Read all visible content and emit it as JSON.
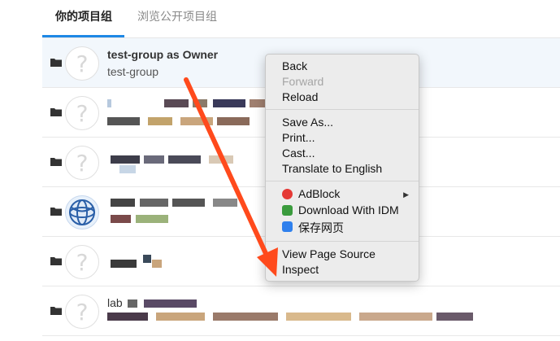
{
  "tabs": [
    {
      "label": "你的项目组",
      "active": true
    },
    {
      "label": "浏览公开项目组",
      "active": false
    }
  ],
  "groups": [
    {
      "name": "test-group as Owner",
      "path": "test-group",
      "avatar": "question-mark"
    },
    {
      "name": "",
      "path": "",
      "avatar": "question-mark"
    },
    {
      "name": "",
      "path": "",
      "avatar": "question-mark"
    },
    {
      "name": "",
      "path": "",
      "avatar": "globe-logo"
    },
    {
      "name": "",
      "path": "",
      "avatar": "question-mark"
    },
    {
      "name": "lab",
      "path": "",
      "avatar": "question-mark"
    }
  ],
  "context_menu": {
    "sections": [
      [
        {
          "label": "Back",
          "enabled": true
        },
        {
          "label": "Forward",
          "enabled": false
        },
        {
          "label": "Reload",
          "enabled": true
        }
      ],
      [
        {
          "label": "Save As...",
          "enabled": true
        },
        {
          "label": "Print...",
          "enabled": true
        },
        {
          "label": "Cast...",
          "enabled": true
        },
        {
          "label": "Translate to English",
          "enabled": true
        }
      ],
      [
        {
          "label": "AdBlock",
          "enabled": true,
          "icon": "adblock-icon",
          "submenu": true
        },
        {
          "label": "Download With IDM",
          "enabled": true,
          "icon": "idm-icon"
        },
        {
          "label": "保存网页",
          "enabled": true,
          "icon": "save-page-icon"
        }
      ],
      [
        {
          "label": "View Page Source",
          "enabled": true
        },
        {
          "label": "Inspect",
          "enabled": true
        }
      ]
    ]
  },
  "colors": {
    "accent": "#1e88e5",
    "annotation_arrow": "#ff4a1c",
    "adblock": "#e53935",
    "idm": "#3a9b3d",
    "save_page": "#2f80ed"
  },
  "icons": {
    "folder": "folder-icon",
    "avatar_placeholder": "question-mark-icon",
    "submenu": "chevron-right-icon"
  }
}
